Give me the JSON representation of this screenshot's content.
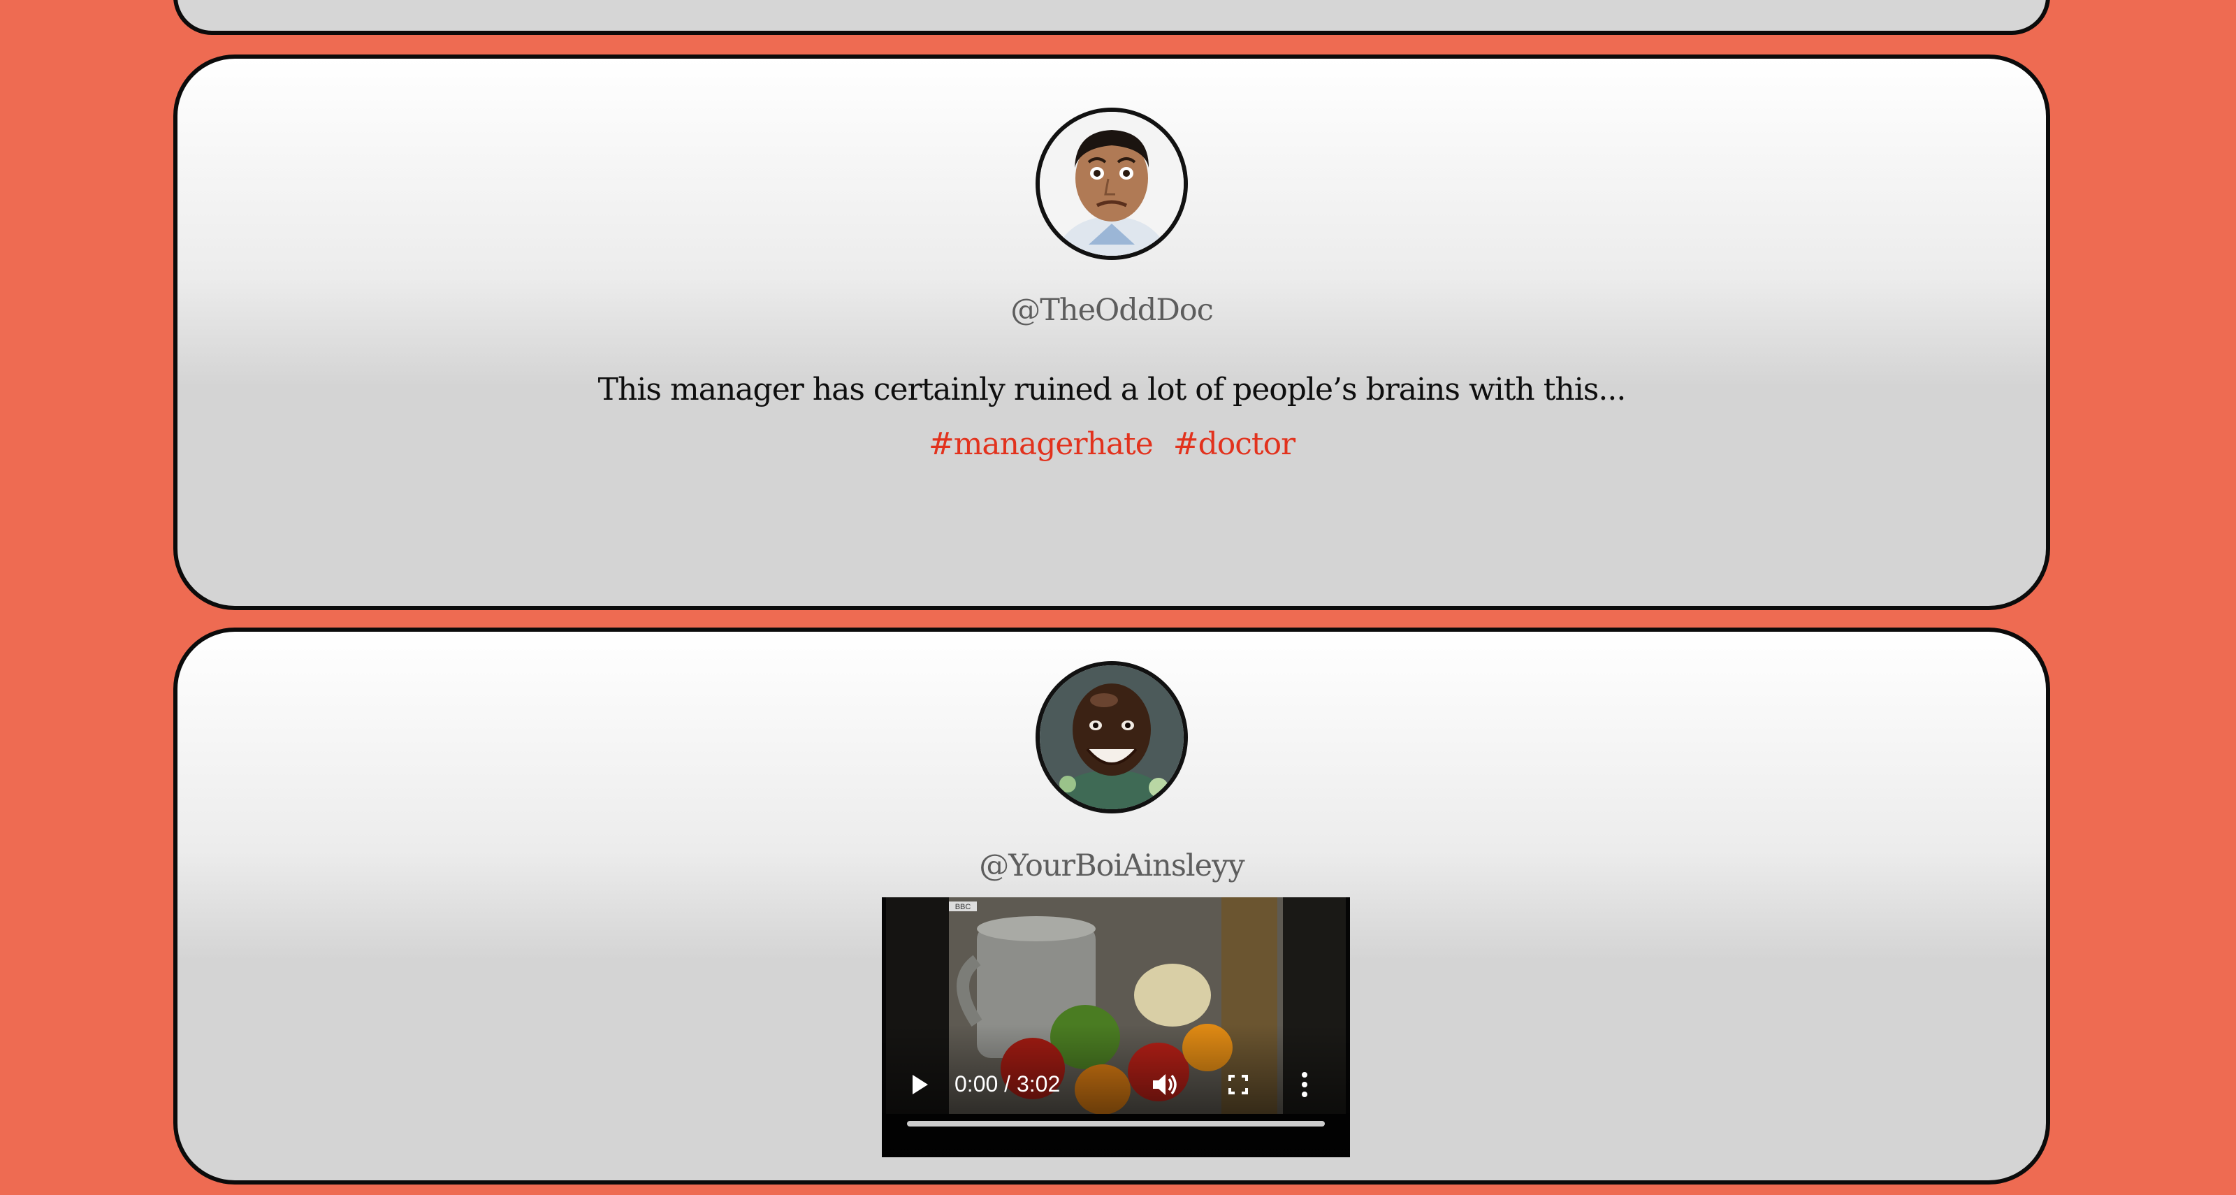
{
  "posts": [
    {
      "handle": "@TheOddDoc",
      "text": "This manager has certainly ruined a lot of people’s brains with this...",
      "tags": [
        "#managerhate",
        "#doctor"
      ],
      "avatar": "doctor-face-avatar"
    },
    {
      "handle": "@YourBoiAinsleyy",
      "avatar": "smiling-man-avatar",
      "video": {
        "time": "0:00 / 3:02",
        "progress": 0,
        "watermark": "BBC"
      }
    }
  ],
  "colors": {
    "background": "#ee6b52",
    "hashtag": "#e2321d",
    "handle": "#5d5d5d",
    "card_border": "#0b0b0b"
  },
  "icons": [
    "play-icon",
    "volume-icon",
    "fullscreen-icon",
    "more-vertical-icon"
  ]
}
